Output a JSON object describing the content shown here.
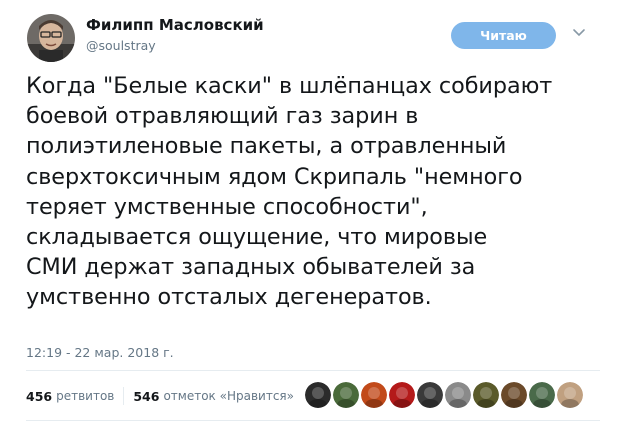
{
  "user": {
    "name": "Филипп Масловский",
    "handle": "@soulstray"
  },
  "follow_button": {
    "label": "Читаю"
  },
  "tweet": {
    "text": "Когда \"Белые каски\" в шлёпанцах собирают\nбоевой отравляющий газ зарин в\nполиэтиленовые пакеты, а отравленный\nсверхтоксичным ядом Скрипаль \"немного\nтеряет умственные способности\",\nскладывается ощущение, что мировые\nСМИ держат западных обывателей за\nумственно отсталых дегенератов.",
    "timestamp": "12:19 - 22 мар. 2018 г."
  },
  "stats": {
    "retweets_count": "456",
    "retweets_label": "ретвитов",
    "likes_count": "546",
    "likes_label": "отметок «Нравится»"
  },
  "liker_avatars": [
    {
      "color": "#2b2b2b"
    },
    {
      "color": "#4a6a3a"
    },
    {
      "color": "#c24a1a"
    },
    {
      "color": "#b41a1a"
    },
    {
      "color": "#3a3a3a"
    },
    {
      "color": "#8a8a8a"
    },
    {
      "color": "#5a5a2a"
    },
    {
      "color": "#6b4a2a"
    },
    {
      "color": "#4a6a4a"
    },
    {
      "color": "#c0a080"
    }
  ],
  "colors": {
    "follow_button_bg": "#7fb6ea",
    "secondary_text": "#657786",
    "primary_text": "#14171a"
  }
}
